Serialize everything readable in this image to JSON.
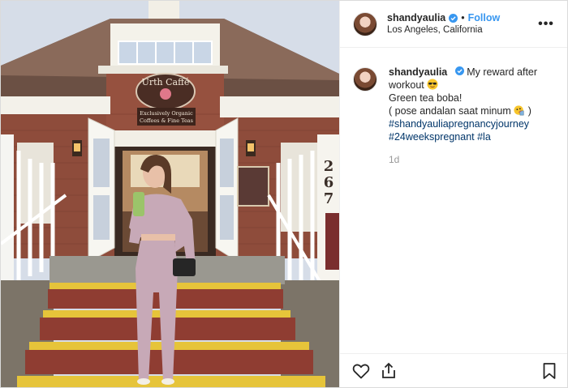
{
  "post": {
    "username": "shandyaulia",
    "follow_label": "Follow",
    "separator": "•",
    "location": "Los Angeles, California",
    "more_label": "•••"
  },
  "caption": {
    "username": "shandyaulia",
    "line1": "My reward after workout",
    "line2": "Green tea boba!",
    "line3_before": "( pose andalan saat minum",
    "line3_after": ")",
    "hashtags": [
      "#shandyauliapregnancyjourney",
      "#24weekspregnant #la"
    ],
    "time": "1d"
  },
  "photo": {
    "sign_top": "Urth Caffé",
    "sign_sub1": "Exclusively Organic",
    "sign_sub2": "Coffees & Fine Teas",
    "address": [
      "2",
      "6",
      "7"
    ]
  },
  "icons": {
    "verified": "verified-badge-icon",
    "like": "heart-icon",
    "share": "share-icon",
    "save": "bookmark-icon",
    "emoji1": "sunglasses-emoji-icon",
    "emoji2": "drinking-emoji-icon"
  },
  "colors": {
    "link": "#003569",
    "follow": "#3897f0",
    "verified": "#3897f0"
  }
}
